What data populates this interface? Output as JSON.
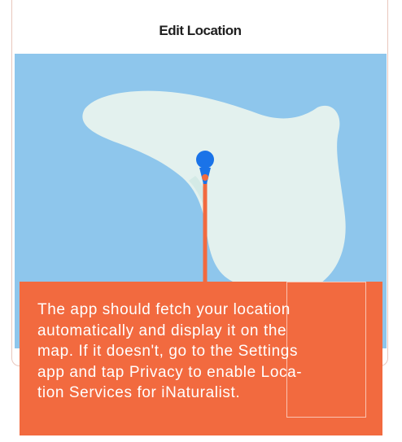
{
  "header": {
    "title": "Edit Location"
  },
  "map": {
    "water_color": "#8ec6ec",
    "land_color": "#e3f1ee",
    "marker_color": "#1a73e8",
    "marker_icon": "location-pin-icon"
  },
  "tooltip": {
    "background": "#f26a3f",
    "lines": [
      "The app should fetch your location",
      "automatically and display it on the",
      "map. If it doesn't,  go to the Settings",
      "app and tap Privacy to enable Loca-",
      "tion Services for iNaturalist."
    ]
  }
}
